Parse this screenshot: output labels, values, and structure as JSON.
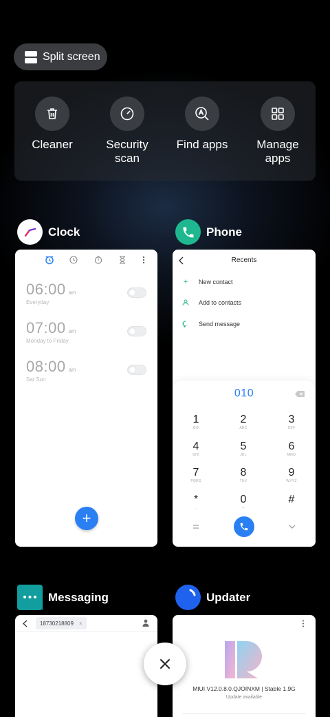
{
  "split_screen": {
    "label": "Split screen"
  },
  "quick_actions": [
    {
      "label": "Cleaner",
      "icon": "trash-icon"
    },
    {
      "label": "Security scan",
      "icon": "security-gauge-icon"
    },
    {
      "label": "Find apps",
      "icon": "find-apps-icon"
    },
    {
      "label": "Manage apps",
      "icon": "grid-icon"
    }
  ],
  "apps": {
    "clock": {
      "name": "Clock",
      "alarms": [
        {
          "time": "06:00",
          "ampm": "am",
          "sub": "Everyday"
        },
        {
          "time": "07:00",
          "ampm": "am",
          "sub": "Monday to Friday"
        },
        {
          "time": "08:00",
          "ampm": "am",
          "sub": "Sat Sun"
        }
      ],
      "fab": "+"
    },
    "phone": {
      "name": "Phone",
      "title": "Recents",
      "options": [
        "New contact",
        "Add to contacts",
        "Send message"
      ],
      "dialed": "010",
      "keys": [
        {
          "d": "1",
          "l": "GO"
        },
        {
          "d": "2",
          "l": "ABC"
        },
        {
          "d": "3",
          "l": "DEF"
        },
        {
          "d": "4",
          "l": "GHI"
        },
        {
          "d": "5",
          "l": "JKL"
        },
        {
          "d": "6",
          "l": "MNO"
        },
        {
          "d": "7",
          "l": "PQRS"
        },
        {
          "d": "8",
          "l": "TUV"
        },
        {
          "d": "9",
          "l": "WXYZ"
        },
        {
          "d": "*",
          "l": ","
        },
        {
          "d": "0",
          "l": "+"
        },
        {
          "d": "#",
          "l": ""
        }
      ]
    },
    "messaging": {
      "name": "Messaging",
      "recipient": "18730218809",
      "chip_close": "×"
    },
    "updater": {
      "name": "Updater",
      "version": "MIUI V12.0.8.0.QJOINXM | Stable 1.9G",
      "status": "Update available",
      "logo_text": "12"
    }
  },
  "colors": {
    "accent_blue": "#2a7ff3",
    "phone_green": "#1eb78f",
    "messaging_teal": "#129e9e",
    "updater_blue": "#1f62ee"
  }
}
